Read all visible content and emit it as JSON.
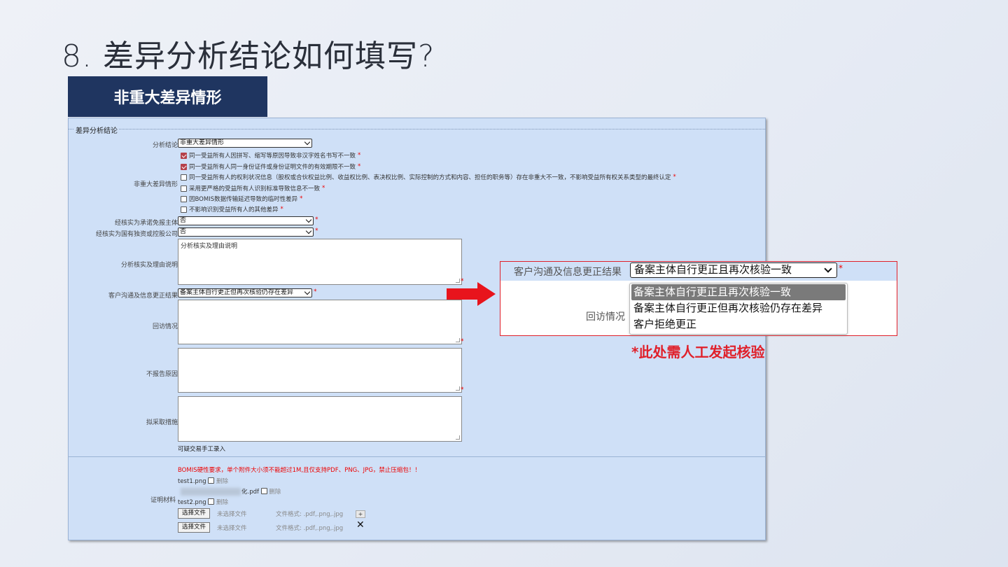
{
  "slide": {
    "title": "8. 差异分析结论如何填写?",
    "banner": "非重大差异情形"
  },
  "form": {
    "legend": "差异分析结论",
    "analysis_conclusion": {
      "label": "分析结论",
      "value": "非重大差异情形"
    },
    "minor_diff": {
      "label": "非重大差异情形",
      "options": [
        {
          "text": "同一受益所有人因拼写、缩写等原因导致非汉字姓名书写不一致",
          "checked": true,
          "req": "*"
        },
        {
          "text": "同一受益所有人同一身份证件或身份证明文件的有效期限不一致",
          "checked": true,
          "req": "*"
        },
        {
          "text": "同一受益所有人的权利状况信息（股权或合伙权益比例、收益权比例、表决权比例、实际控制的方式和内容、担任的职务等）存在非重大不一致，不影响受益所有权关系类型的最终认定",
          "checked": false,
          "req": "*"
        },
        {
          "text": "采用更严格的受益所有人识别标准导致信息不一致",
          "checked": false,
          "req": "*"
        },
        {
          "text": "因BOMIS数据传输延迟导致的临时性差异",
          "checked": false,
          "req": "*"
        },
        {
          "text": "不影响识别受益所有人的其他差异",
          "checked": false,
          "req": "*"
        }
      ]
    },
    "exempt_subject": {
      "label": "经核实为承诺免报主体",
      "value": "否"
    },
    "state_owned": {
      "label": "经核实为国有独资或控股公司",
      "value": "否"
    },
    "verify_reason": {
      "label": "分析核实及理由说明",
      "value": "分析核实及理由说明"
    },
    "comm_result": {
      "label": "客户沟通及信息更正结果",
      "value": "备案主体自行更正但再次核验仍存在差异"
    },
    "revisit": {
      "label": "回访情况",
      "value": ""
    },
    "no_report_reason": {
      "label": "不报告原因",
      "value": ""
    },
    "measures": {
      "label": "拟采取措施",
      "value": ""
    },
    "manual_entry": "可疑交易手工录入",
    "proof": {
      "label": "证明材料",
      "warning": "BOMIS硬性要求，单个附件大小须不能超过1M,且仅支持PDF、PNG、JPG，禁止压缩包！！",
      "files": [
        {
          "name": "test1.png",
          "delete": "删除"
        },
        {
          "name": "化.pdf",
          "delete": "删除"
        },
        {
          "name": "test2.png",
          "delete": "删除"
        }
      ],
      "choose_label": "选择文件",
      "no_file": "未选择文件",
      "format_hint": "文件格式: .pdf,.png,.jpg",
      "plus": "+",
      "remove": "✕"
    },
    "req_mark": "*"
  },
  "callout": {
    "label": "客户沟通及信息更正结果",
    "selected": "备案主体自行更正且再次核验一致",
    "visit_label": "回访情况",
    "options": [
      "备案主体自行更正且再次核验一致",
      "备案主体自行更正但再次核验仍存在差异",
      "客户拒绝更正"
    ],
    "req_mark": "*",
    "note": "*此处需人工发起核验"
  },
  "colors": {
    "banner": "#1f3560",
    "panel": "#cfe0f7",
    "accent_red": "#e0202a"
  }
}
